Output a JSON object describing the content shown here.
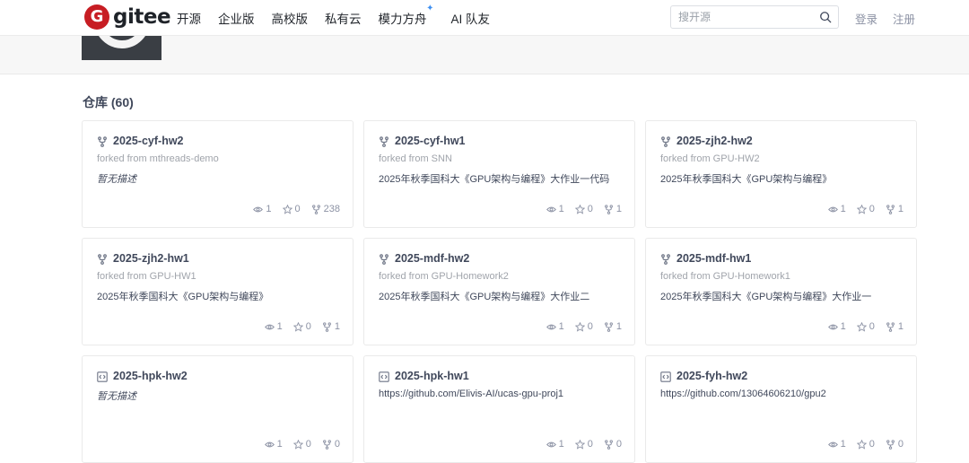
{
  "nav": {
    "logo_letter": "G",
    "logo_text": "gitee",
    "links": [
      "开源",
      "企业版",
      "高校版",
      "私有云",
      "模力方舟",
      "AI 队友"
    ],
    "search_placeholder": "搜开源",
    "login": "登录",
    "register": "注册"
  },
  "section": {
    "label": "仓库",
    "count": "(60)"
  },
  "repos": [
    {
      "name": "2025-cyf-hw2",
      "icon": "fork-icon",
      "forked": "forked from mthreads-demo",
      "desc": "暂无描述",
      "watch": "1",
      "star": "0",
      "fork": "238"
    },
    {
      "name": "2025-cyf-hw1",
      "icon": "fork-icon",
      "forked": "forked from SNN",
      "desc": "2025年秋季国科大《GPU架构与编程》大作业一代码",
      "watch": "1",
      "star": "0",
      "fork": "1"
    },
    {
      "name": "2025-zjh2-hw2",
      "icon": "fork-icon",
      "forked": "forked from GPU-HW2",
      "desc": "2025年秋季国科大《GPU架构与编程》",
      "watch": "1",
      "star": "0",
      "fork": "1"
    },
    {
      "name": "2025-zjh2-hw1",
      "icon": "fork-icon",
      "forked": "forked from GPU-HW1",
      "desc": "2025年秋季国科大《GPU架构与编程》",
      "watch": "1",
      "star": "0",
      "fork": "1"
    },
    {
      "name": "2025-mdf-hw2",
      "icon": "fork-icon",
      "forked": "forked from GPU-Homework2",
      "desc": "2025年秋季国科大《GPU架构与编程》大作业二",
      "watch": "1",
      "star": "0",
      "fork": "1"
    },
    {
      "name": "2025-mdf-hw1",
      "icon": "fork-icon",
      "forked": "forked from GPU-Homework1",
      "desc": "2025年秋季国科大《GPU架构与编程》大作业一",
      "watch": "1",
      "star": "0",
      "fork": "1"
    },
    {
      "name": "2025-hpk-hw2",
      "icon": "code-icon",
      "forked": "",
      "desc": "暂无描述",
      "watch": "1",
      "star": "0",
      "fork": "0"
    },
    {
      "name": "2025-hpk-hw1",
      "icon": "code-icon",
      "forked": "",
      "desc": "https://github.com/Elivis-AI/ucas-gpu-proj1",
      "watch": "1",
      "star": "0",
      "fork": "0"
    },
    {
      "name": "2025-fyh-hw2",
      "icon": "code-icon",
      "forked": "",
      "desc": "https://github.com/13064606210/gpu2",
      "watch": "1",
      "star": "0",
      "fork": "0"
    }
  ]
}
